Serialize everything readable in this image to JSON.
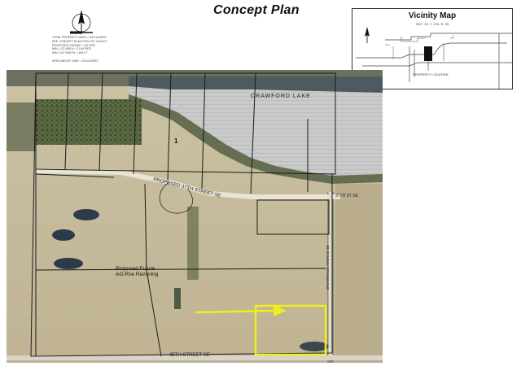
{
  "title": "Concept Plan",
  "north_arrow": {
    "icon": "north-arrow-icon",
    "letter": "N"
  },
  "notes": [
    "TOTAL PROPERTY AREA = 40.8 ACRES",
    "SEE CONCEPT PLAN FOR LOT LAYOUT",
    "PROPOSED ZONING = AG-RSE",
    "MIN. LOT AREA = 2.5 ACRES",
    "MIN. LOT WIDTH = 165 FT",
    "",
    "AREA ABOVE OHW = 35.8 ACRES"
  ],
  "vicinity_map": {
    "title": "Vicinity Map",
    "subtitle": "SEC. 20, T. 17N, R. 25",
    "location_label": "PROPERTY LOCATION",
    "marker_color": "#111111"
  },
  "site_map": {
    "lake_label": "CRAWFORD LAKE",
    "street_labels": {
      "proposed_street": "PROPOSED 37TH STREET SE",
      "street_37th": "37TH ST SE",
      "street_45th": "45TH STREET SE",
      "avenue": "BRIARWOOD AVENUE SE"
    },
    "lot_number": "1",
    "rezoning_label_1": "Proposed Future",
    "rezoning_label_2": "AG-Rse Rezoning",
    "highlight_color": "#f2ee1c",
    "arrow_color": "#f2ee1c",
    "lot_line_color": "#1a1a1a"
  }
}
